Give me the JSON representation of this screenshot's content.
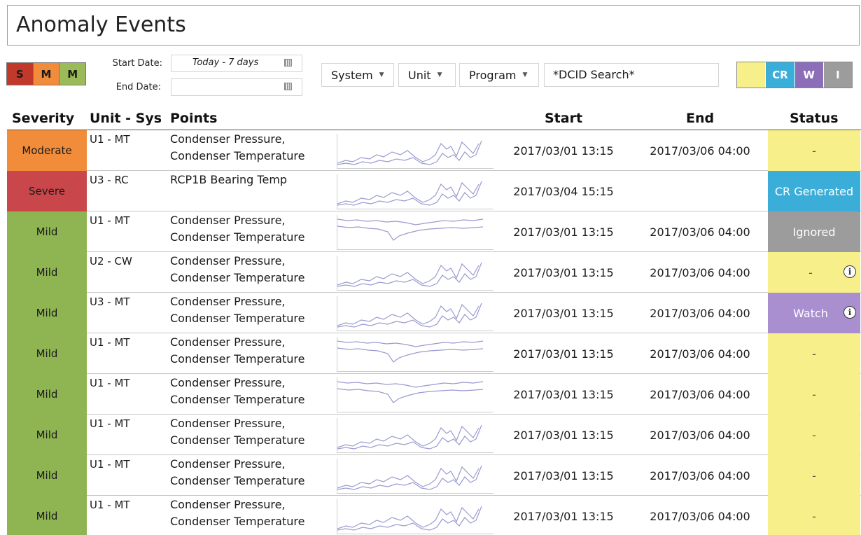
{
  "header": {
    "title": "Anomaly Events"
  },
  "filters": {
    "severity_buttons": [
      {
        "label": "S",
        "color": "#c0392b"
      },
      {
        "label": "M",
        "color": "#f08c3a"
      },
      {
        "label": "M",
        "color": "#9bbb59"
      }
    ],
    "start_date_label": "Start Date:",
    "start_date_value": "Today - 7 days",
    "end_date_label": "End Date:",
    "end_date_value": "",
    "system_label": "System",
    "unit_label": "Unit",
    "program_label": "Program",
    "search_value": "*DCID Search*",
    "status_buttons": [
      {
        "label": "",
        "color": "#f7f08a"
      },
      {
        "label": "CR",
        "color": "#3aaed8"
      },
      {
        "label": "W",
        "color": "#8b6db8"
      },
      {
        "label": "I",
        "color": "#9c9c9c"
      }
    ]
  },
  "table": {
    "columns": [
      "Severity",
      "Unit - Sys",
      "Points",
      "Start",
      "End",
      "Status"
    ],
    "rows": [
      {
        "severity": "Moderate",
        "unit_sys": "U1 - MT",
        "points": [
          "Condenser Pressure,",
          "Condenser Temperature"
        ],
        "spark": "A",
        "start": "2017/03/01 13:15",
        "end": "2017/03/06 04:00",
        "status": "-",
        "status_color": "#f7f08a",
        "info": false
      },
      {
        "severity": "Severe",
        "unit_sys": "U3 - RC",
        "points": [
          "RCP1B Bearing Temp",
          ""
        ],
        "spark": "A",
        "start": "2017/03/04 15:15",
        "end": "",
        "status": "CR Generated",
        "status_color": "#3aaed8",
        "info": false
      },
      {
        "severity": "Mild",
        "unit_sys": "U1 - MT",
        "points": [
          "Condenser Pressure,",
          "Condenser Temperature"
        ],
        "spark": "B",
        "start": "2017/03/01 13:15",
        "end": "2017/03/06 04:00",
        "status": "Ignored",
        "status_color": "#9c9c9c",
        "info": false
      },
      {
        "severity": "Mild",
        "unit_sys": "U2 - CW",
        "points": [
          "Condenser Pressure,",
          "Condenser Temperature"
        ],
        "spark": "A",
        "start": "2017/03/01 13:15",
        "end": "2017/03/06 04:00",
        "status": "-",
        "status_color": "#f7f08a",
        "info": true
      },
      {
        "severity": "Mild",
        "unit_sys": "U3 - MT",
        "points": [
          "Condenser Pressure,",
          "Condenser Temperature"
        ],
        "spark": "A",
        "start": "2017/03/01 13:15",
        "end": "2017/03/06 04:00",
        "status": "Watch",
        "status_color": "#a98fcf",
        "info": true
      },
      {
        "severity": "Mild",
        "unit_sys": "U1 - MT",
        "points": [
          "Condenser Pressure,",
          "Condenser Temperature"
        ],
        "spark": "B",
        "start": "2017/03/01 13:15",
        "end": "2017/03/06 04:00",
        "status": "-",
        "status_color": "#f7f08a",
        "info": false
      },
      {
        "severity": "Mild",
        "unit_sys": "U1 - MT",
        "points": [
          "Condenser Pressure,",
          "Condenser Temperature"
        ],
        "spark": "B",
        "start": "2017/03/01 13:15",
        "end": "2017/03/06 04:00",
        "status": "-",
        "status_color": "#f7f08a",
        "info": false
      },
      {
        "severity": "Mild",
        "unit_sys": "U1 - MT",
        "points": [
          "Condenser Pressure,",
          "Condenser Temperature"
        ],
        "spark": "A",
        "start": "2017/03/01 13:15",
        "end": "2017/03/06 04:00",
        "status": "-",
        "status_color": "#f7f08a",
        "info": false
      },
      {
        "severity": "Mild",
        "unit_sys": "U1 - MT",
        "points": [
          "Condenser Pressure,",
          "Condenser Temperature"
        ],
        "spark": "A",
        "start": "2017/03/01 13:15",
        "end": "2017/03/06 04:00",
        "status": "-",
        "status_color": "#f7f08a",
        "info": false
      },
      {
        "severity": "Mild",
        "unit_sys": "U1 - MT",
        "points": [
          "Condenser Pressure,",
          "Condenser Temperature"
        ],
        "spark": "A",
        "start": "2017/03/01 13:15",
        "end": "2017/03/06 04:00",
        "status": "-",
        "status_color": "#f7f08a",
        "info": false
      }
    ]
  },
  "colors": {
    "Moderate": "#f08c3a",
    "Severe": "#c9474b",
    "Mild": "#8fb553",
    "spark_line": "#9a9ad0"
  }
}
